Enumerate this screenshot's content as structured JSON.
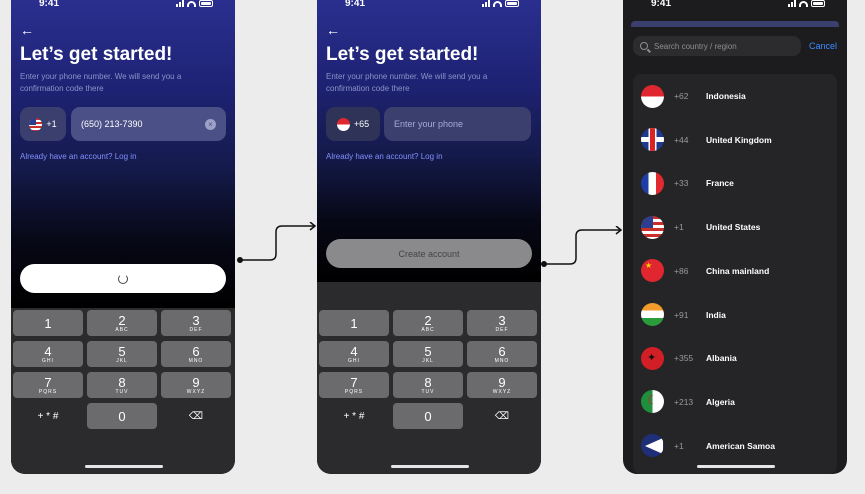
{
  "status": {
    "time": "9:41"
  },
  "screen1": {
    "title": "Let’s get started!",
    "subtitle": "Enter your phone number. We will send you a confirmation code there",
    "country_code": "+1",
    "phone_value": "(650) 213-7390",
    "login_link": "Already have an account? Log in"
  },
  "screen2": {
    "title": "Let’s get started!",
    "subtitle": "Enter your phone number. We will send you a confirmation code there",
    "country_code": "+65",
    "phone_placeholder": "Enter your phone",
    "login_link": "Already have an account? Log in",
    "create_button": "Create account"
  },
  "keypad": [
    {
      "num": "1",
      "letters": ""
    },
    {
      "num": "2",
      "letters": "ABC"
    },
    {
      "num": "3",
      "letters": "DEF"
    },
    {
      "num": "4",
      "letters": "GHI"
    },
    {
      "num": "5",
      "letters": "JKL"
    },
    {
      "num": "6",
      "letters": "MNO"
    },
    {
      "num": "7",
      "letters": "PQRS"
    },
    {
      "num": "8",
      "letters": "TUV"
    },
    {
      "num": "9",
      "letters": "WXYZ"
    }
  ],
  "keypad_symbols": "+ * #",
  "keypad_zero": "0",
  "screen3": {
    "search_placeholder": "Search country / region",
    "cancel_label": "Cancel",
    "countries": [
      {
        "code": "+62",
        "name": "Indonesia",
        "flag": "id"
      },
      {
        "code": "+44",
        "name": "United Kingdom",
        "flag": "uk"
      },
      {
        "code": "+33",
        "name": "France",
        "flag": "fr"
      },
      {
        "code": "+1",
        "name": "United States",
        "flag": "us"
      },
      {
        "code": "+86",
        "name": "China mainland",
        "flag": "cn"
      },
      {
        "code": "+91",
        "name": "India",
        "flag": "in"
      },
      {
        "code": "+355",
        "name": "Albania",
        "flag": "al"
      },
      {
        "code": "+213",
        "name": "Algeria",
        "flag": "dz"
      },
      {
        "code": "+1",
        "name": "American Samoa",
        "flag": "as"
      }
    ]
  }
}
